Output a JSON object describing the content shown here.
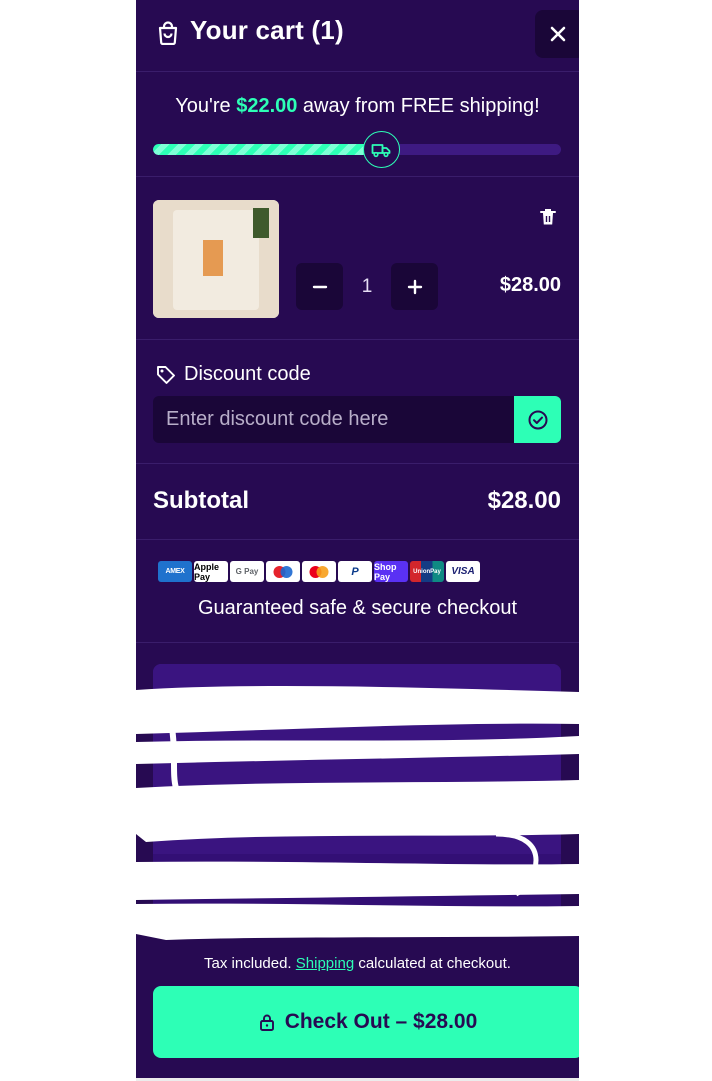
{
  "header": {
    "title": "Your cart (1)",
    "icons": {
      "bag": "shopping-bag-icon",
      "close": "close-icon"
    }
  },
  "shipping_progress": {
    "prefix": "You're ",
    "amount": "$22.00",
    "suffix": " away from FREE shipping!",
    "progress_fraction": 0.56,
    "icon": "truck-icon"
  },
  "line_item": {
    "name": "",
    "quantity": "1",
    "price": "$28.00",
    "icons": {
      "remove": "trash-icon",
      "minus": "minus-icon",
      "plus": "plus-icon"
    }
  },
  "discount": {
    "label": "Discount code",
    "placeholder": "Enter discount code here",
    "value": "",
    "icons": {
      "tag": "tag-icon",
      "apply": "check-circle-icon"
    }
  },
  "subtotal": {
    "label": "Subtotal",
    "value": "$28.00"
  },
  "payments": {
    "methods": [
      "AMEX",
      "Apple Pay",
      "G Pay",
      "Maestro",
      "Mastercard",
      "PayPal",
      "Shop Pay",
      "UnionPay",
      "VISA"
    ],
    "secure_text": "Guaranteed safe & secure checkout"
  },
  "footer": {
    "tax_text_before": "Tax included. ",
    "shipping_link": "Shipping",
    "tax_text_after": " calculated at checkout.",
    "checkout_label": "Check Out – $28.00",
    "icons": {
      "checkout": "lock-icon"
    }
  },
  "colors": {
    "background": "#270a52",
    "accent": "#2dffb6",
    "control_bg": "#1a0638",
    "progress_track": "#3e1a82"
  }
}
